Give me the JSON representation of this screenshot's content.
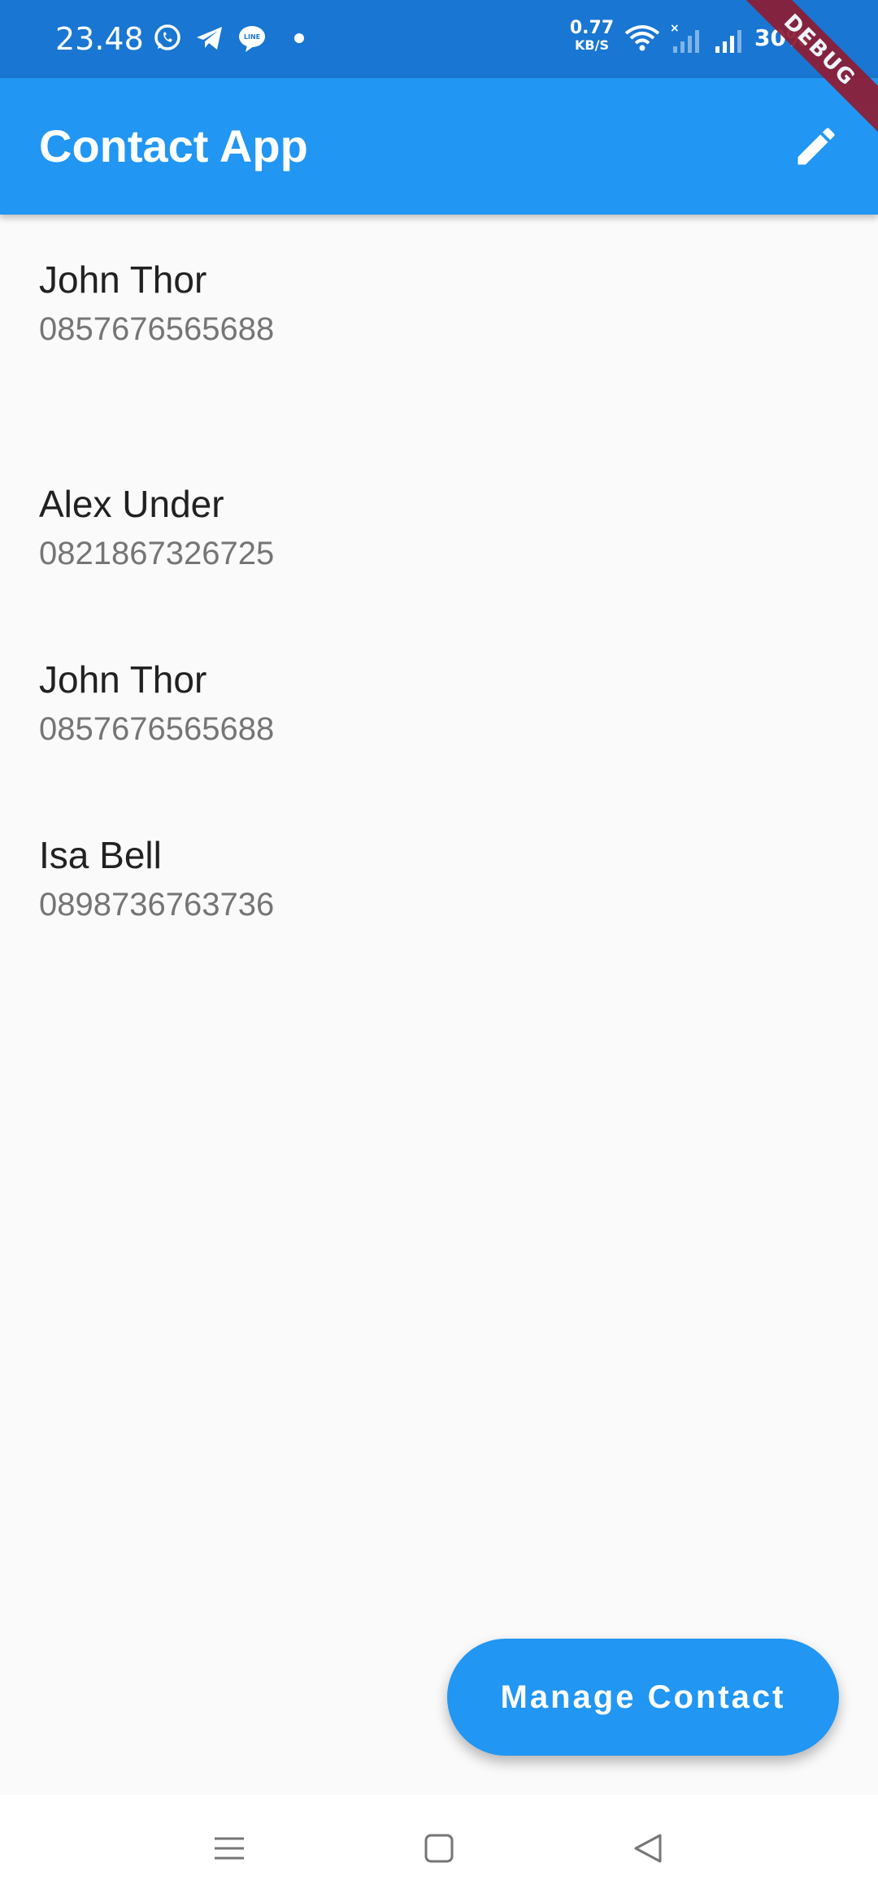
{
  "status_bar": {
    "time": "23.48",
    "notification_icons": [
      "whatsapp-icon",
      "telegram-icon",
      "line-icon"
    ],
    "speed_value": "0.77",
    "speed_unit": "KB/S",
    "battery": "30%",
    "debug_label": "DEBUG"
  },
  "app_bar": {
    "title": "Contact App",
    "action_icon": "edit-icon"
  },
  "contacts": [
    {
      "name": "John Thor",
      "phone": "0857676565688"
    },
    {
      "name": "Alex Under",
      "phone": "0821867326725"
    },
    {
      "name": "John Thor",
      "phone": "0857676565688"
    },
    {
      "name": "Isa Bell",
      "phone": "0898736763736"
    }
  ],
  "fab": {
    "label": "Manage Contact"
  },
  "nav_bar": {
    "buttons": [
      "menu-icon",
      "home-icon",
      "back-icon"
    ]
  },
  "colors": {
    "status_bar": "#1976d2",
    "primary": "#2196f3",
    "background": "#fafafa",
    "name_text": "#212121",
    "phone_text": "#757575",
    "debug_ribbon": "#8e1c33"
  }
}
